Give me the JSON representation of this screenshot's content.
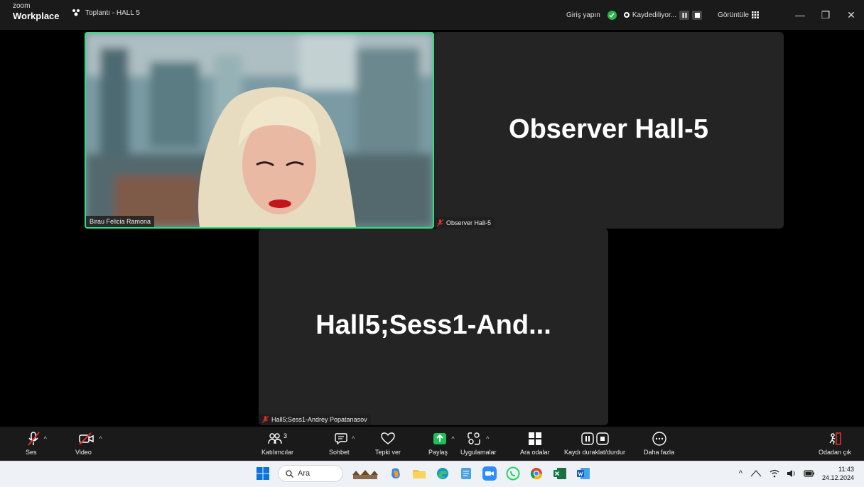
{
  "titlebar": {
    "brand_small": "zoom",
    "brand_large": "Workplace",
    "meeting_title": "Toplantı - HALL 5",
    "signin": "Giriş yapın",
    "recording": "Kaydediliyor...",
    "view": "Görüntüle",
    "window_buttons": [
      "—",
      "❐",
      "✕"
    ]
  },
  "tiles": {
    "video_name": "Birau Felicia Ramona",
    "observer_title": "Observer Hall-5",
    "observer_name": "Observer Hall-5",
    "hall5_title": "Hall5;Sess1-And...",
    "hall5_name": "Hall5;Sess1-Andrey Popatanasov"
  },
  "toolbar": {
    "audio": "Ses",
    "video": "Video",
    "participants": "Katılımcılar",
    "participants_count": "3",
    "chat": "Sohbet",
    "react": "Tepki ver",
    "share": "Paylaş",
    "apps": "Uygulamalar",
    "breakout": "Ara odalar",
    "record": "Kaydı duraklat/durdur",
    "more": "Daha fazla",
    "leave": "Odadan çık"
  },
  "taskbar": {
    "search_placeholder": "Ara",
    "time": "11:43",
    "date": "24.12.2024",
    "apps": [
      "windows-start",
      "search",
      "widgets",
      "copilot",
      "file-explorer",
      "edge",
      "notepad",
      "zoom",
      "whatsapp",
      "chrome",
      "excel",
      "word"
    ]
  },
  "colors": {
    "active_speaker": "#2fe07a",
    "mute_red": "#e0302e",
    "share_green": "#1fbf5a",
    "background": "#000000",
    "tile": "#242424"
  }
}
